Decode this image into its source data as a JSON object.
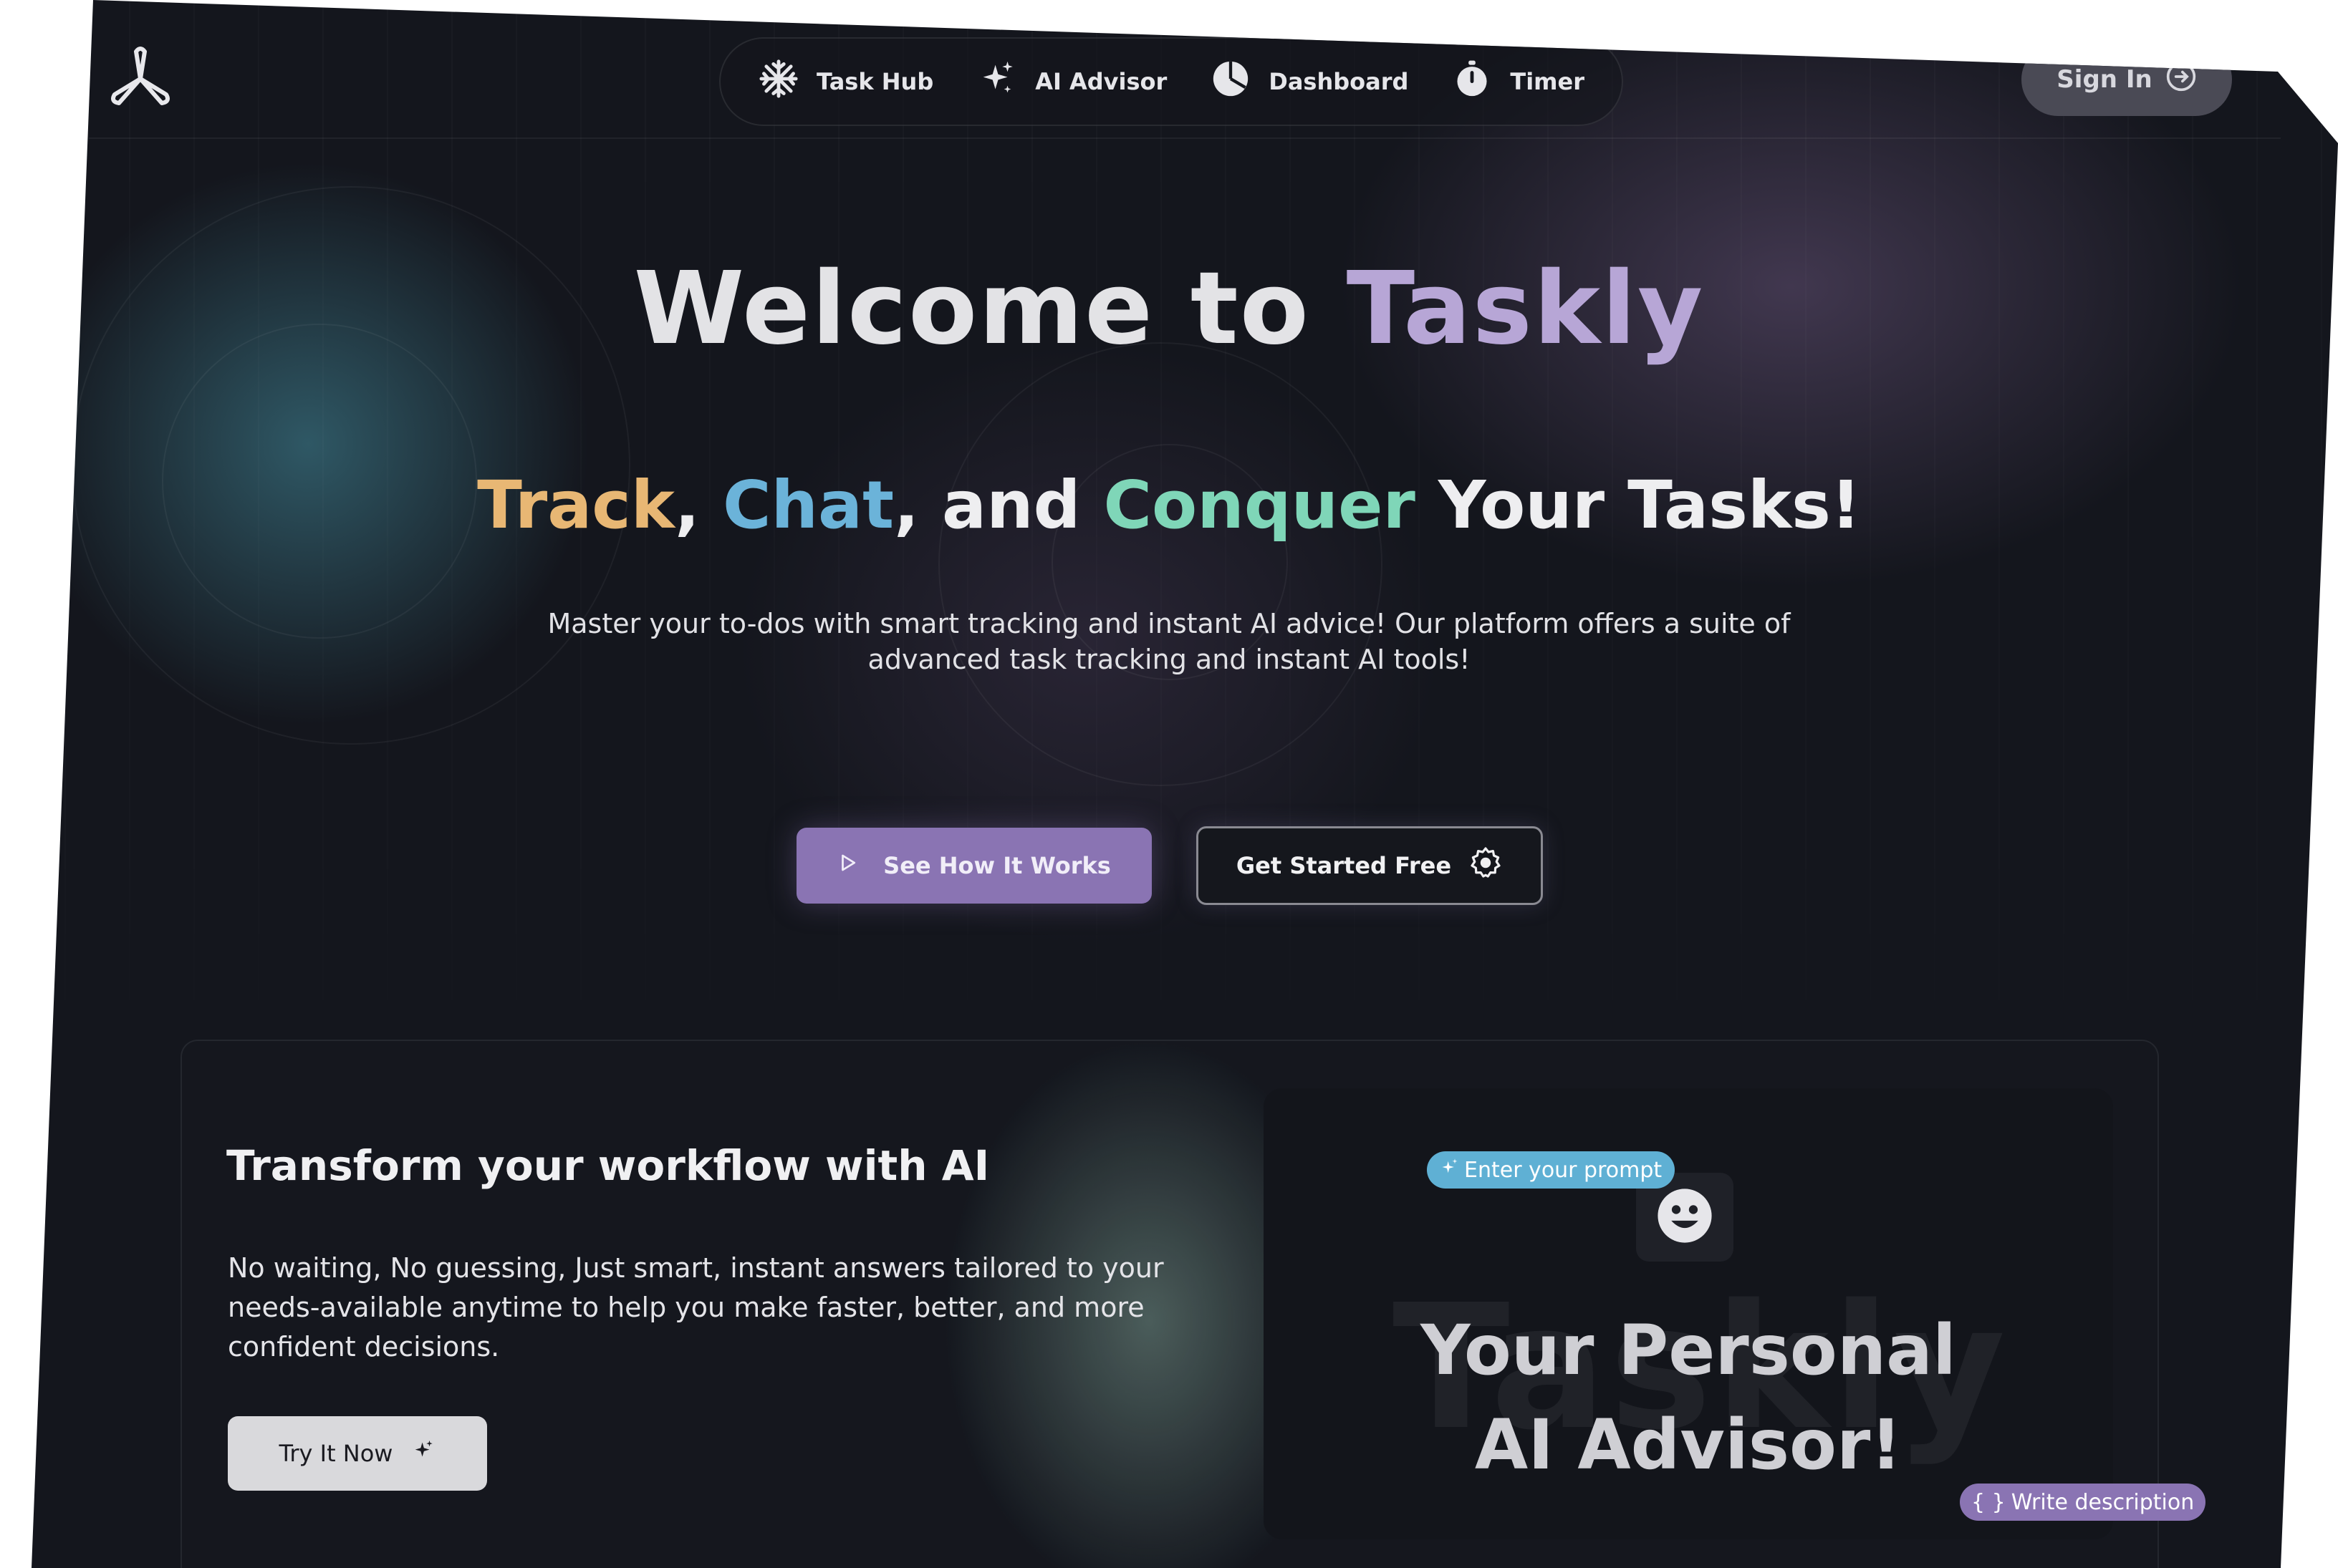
{
  "nav": {
    "items": [
      {
        "label": "Task Hub",
        "icon": "snowflake-icon"
      },
      {
        "label": "AI Advisor",
        "icon": "sparkles-icon"
      },
      {
        "label": "Dashboard",
        "icon": "pie-chart-icon"
      },
      {
        "label": "Timer",
        "icon": "stopwatch-icon"
      }
    ],
    "signin_label": "Sign In"
  },
  "hero": {
    "title_prefix": "Welcome to ",
    "title_brand": "Taskly",
    "sub_track": "Track",
    "sub_comma1": ", ",
    "sub_chat": "Chat",
    "sub_and": ", and ",
    "sub_conquer": "Conquer",
    "sub_rest": " Your Tasks!",
    "desc_line1": "Master your to-dos with smart tracking and instant AI advice! Our platform offers a suite of",
    "desc_line2": "advanced task tracking and instant AI tools!",
    "primary_button": "See How It Works",
    "secondary_button": "Get Started Free"
  },
  "feature": {
    "title": "Transform your workflow with AI",
    "desc_line1": "No waiting, No guessing, Just smart, instant answers tailored to your",
    "desc_line2": "needs-available anytime to help you make faster, better, and more",
    "desc_line3": "confident decisions.",
    "button": "Try It Now",
    "panel": {
      "watermark": "Taskly",
      "heading_line1": "Your Personal",
      "heading_line2": "AI Advisor!",
      "chip_prompt": "Enter your prompt",
      "chip_description": "Write description"
    }
  },
  "colors": {
    "background": "#14161d",
    "brand": "#b7a6d6",
    "track": "#e8b774",
    "chat": "#6bb3d9",
    "conquer": "#7fd6b8",
    "primary_button": "#8a74b3",
    "chip_prompt": "#5fb0d4"
  }
}
